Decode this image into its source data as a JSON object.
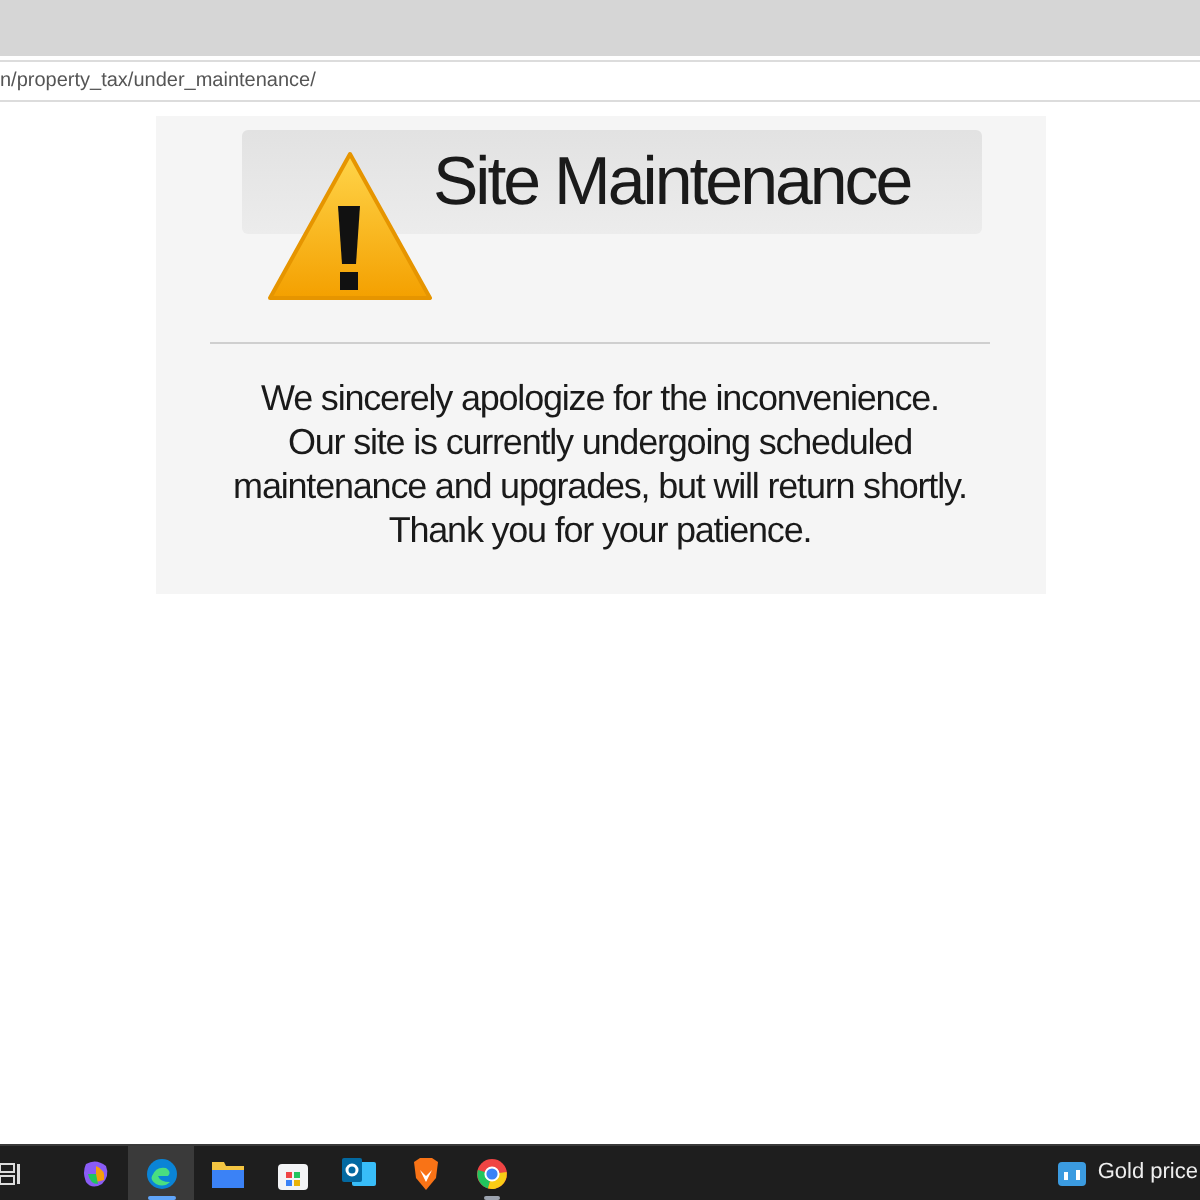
{
  "address_bar": {
    "url": "n/property_tax/under_maintenance/"
  },
  "notice": {
    "title": "Site Maintenance",
    "message_lines": [
      "We sincerely apologize for the inconvenience.",
      "Our site is currently undergoing scheduled",
      "maintenance and upgrades, but will return shortly.",
      "Thank you for your patience."
    ]
  },
  "taskbar": {
    "apps": [
      {
        "kind": "copilot",
        "selected": false,
        "running": false
      },
      {
        "kind": "edge",
        "selected": true,
        "running": true
      },
      {
        "kind": "files",
        "selected": false,
        "running": false
      },
      {
        "kind": "store",
        "selected": false,
        "running": false
      },
      {
        "kind": "outlook",
        "selected": false,
        "running": false
      },
      {
        "kind": "brave",
        "selected": false,
        "running": false
      },
      {
        "kind": "chrome",
        "selected": false,
        "running": true
      }
    ],
    "widget": {
      "label": "Gold price"
    }
  }
}
